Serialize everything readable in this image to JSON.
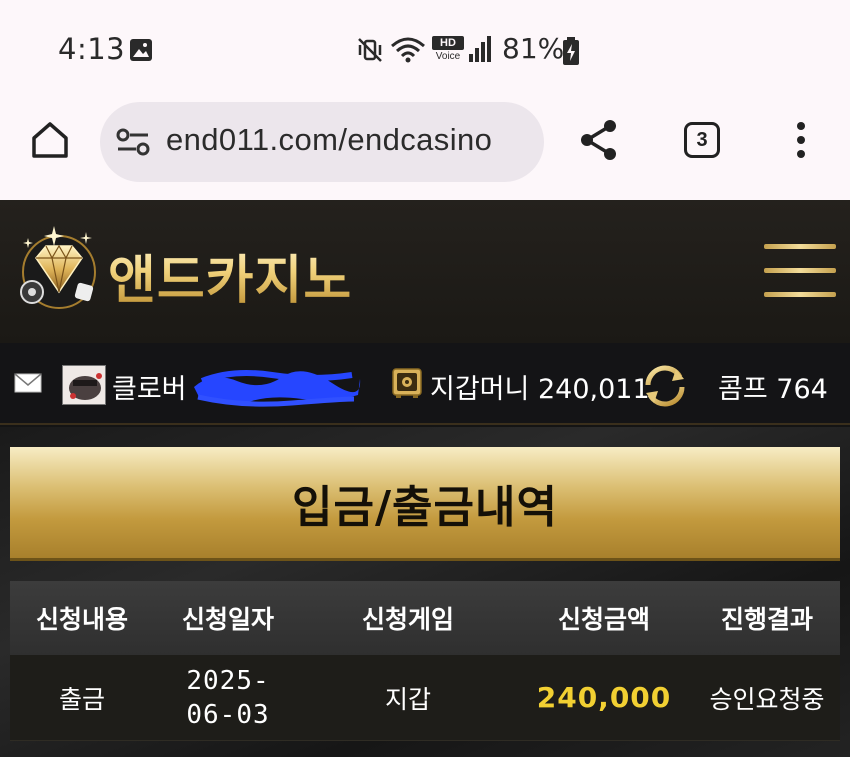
{
  "statusbar": {
    "time": "4:13",
    "network_label": "HD Voice",
    "battery_pct": "81%"
  },
  "browser": {
    "url": "end011.com/endcasino",
    "tab_count": "3"
  },
  "site": {
    "logo_text": "앤드카지노"
  },
  "userbar": {
    "grade": "클로버",
    "wallet_label": "지갑머니",
    "wallet_amount": "240,011",
    "comp_label": "콤프",
    "comp_amount": "764"
  },
  "page": {
    "title": "입금/출금내역"
  },
  "table": {
    "headers": [
      "신청내용",
      "신청일자",
      "신청게임",
      "신청금액",
      "진행결과"
    ],
    "rows": [
      {
        "type": "출금",
        "date": "2025-06-03",
        "game": "지갑",
        "amount": "240,000",
        "status": "승인요청중"
      }
    ]
  },
  "colors": {
    "gold": "#dcc075",
    "amount_yellow": "#f2d032",
    "dark_bg": "#141414"
  }
}
